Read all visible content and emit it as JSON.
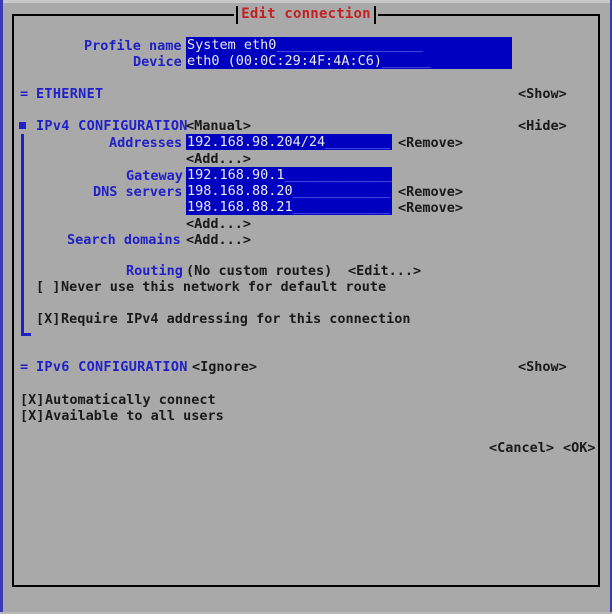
{
  "window": {
    "title": "Edit connection"
  },
  "form": {
    "profile_name": {
      "label": "Profile name",
      "value": "System eth0",
      "fill": "__________________"
    },
    "device": {
      "label": "Device",
      "value": "eth0 (00:0C:29:4F:4A:C6)",
      "fill": "______"
    }
  },
  "sections": {
    "ethernet": {
      "marker": "=",
      "label": "ETHERNET",
      "toggle": "<Show>"
    },
    "ipv4": {
      "marker": "▪",
      "label": "IPv4 CONFIGURATION",
      "mode": "<Manual>",
      "toggle": "<Hide>",
      "addresses": {
        "label": "Addresses",
        "entries": [
          {
            "value": "192.168.98.204/24",
            "fill": "________",
            "remove": "<Remove>"
          }
        ],
        "add": "<Add...>"
      },
      "gateway": {
        "label": "Gateway",
        "value": "192.168.90.1",
        "fill": "______________"
      },
      "dns": {
        "label": "DNS servers",
        "entries": [
          {
            "value": "198.168.88.20",
            "fill": "____________",
            "remove": "<Remove>"
          },
          {
            "value": "198.168.88.21",
            "fill": "____________",
            "remove": "<Remove>"
          }
        ],
        "add": "<Add...>"
      },
      "search_domains": {
        "label": "Search domains",
        "add": "<Add...>"
      },
      "routing": {
        "label": "Routing",
        "value": "(No custom routes)",
        "edit": "<Edit...>"
      },
      "never_default": {
        "checkbox": "[ ]",
        "label": "Never use this network for default route"
      },
      "require_ipv4": {
        "checkbox": "[X]",
        "label": "Require IPv4 addressing for this connection"
      }
    },
    "ipv6": {
      "marker": "=",
      "label": "IPv6 CONFIGURATION",
      "mode": "<Ignore>",
      "toggle": "<Show>"
    }
  },
  "options": [
    {
      "checkbox": "[X]",
      "label": "Automatically connect"
    },
    {
      "checkbox": "[X]",
      "label": "Available to all users"
    }
  ],
  "buttons": {
    "cancel": "<Cancel>",
    "ok": "<OK>"
  },
  "colors": {
    "background": "#a9a9a9",
    "label_blue": "#2020c8",
    "field_blue": "#0000c0",
    "title_red": "#c42020",
    "text_dark": "#1a1a1a"
  }
}
